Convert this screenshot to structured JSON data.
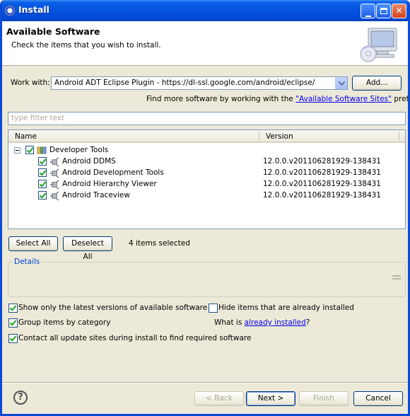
{
  "window": {
    "title": "Install"
  },
  "header": {
    "title": "Available Software",
    "subtitle": "Check the items that you wish to install."
  },
  "work_with": {
    "label": "Work with:",
    "value": "Android ADT Eclipse Plugin - https://dl-ssl.google.com/android/eclipse/",
    "add_label": "Add...",
    "hint_prefix": "Find more software by working with the ",
    "hint_link": "\"Available Software Sites\"",
    "hint_suffix": " preferences."
  },
  "filter": {
    "placeholder": "type filter text"
  },
  "table": {
    "columns": [
      "Name",
      "Version"
    ],
    "group": {
      "name": "Developer Tools",
      "checked": true,
      "expanded": true
    },
    "rows": [
      {
        "name": "Android DDMS",
        "version": "12.0.0.v201106281929-138431",
        "checked": true
      },
      {
        "name": "Android Development Tools",
        "version": "12.0.0.v201106281929-138431",
        "checked": true
      },
      {
        "name": "Android Hierarchy Viewer",
        "version": "12.0.0.v201106281929-138431",
        "checked": true
      },
      {
        "name": "Android Traceview",
        "version": "12.0.0.v201106281929-138431",
        "checked": true
      }
    ]
  },
  "selection": {
    "select_all": "Select All",
    "deselect_all": "Deselect All",
    "status": "4 items selected"
  },
  "details": {
    "label": "Details"
  },
  "options": {
    "latest_versions": {
      "label": "Show only the latest versions of available software",
      "checked": true
    },
    "hide_installed": {
      "label": "Hide items that are already installed",
      "checked": false
    },
    "group_by_category": {
      "label": "Group items by category",
      "checked": true
    },
    "what_is_prefix": "What is ",
    "what_is_link": "already installed",
    "what_is_suffix": "?",
    "contact_sites": {
      "label": "Contact all update sites during install to find required software",
      "checked": true
    }
  },
  "buttons": {
    "back": "< Back",
    "next": "Next >",
    "finish": "Finish",
    "cancel": "Cancel"
  },
  "colors": {
    "titlebar": "#0553e0",
    "dialog_bg": "#ece9d8",
    "link": "#0000ee",
    "group_label": "#0046d5"
  }
}
